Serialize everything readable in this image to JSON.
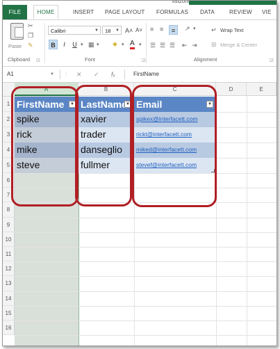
{
  "window": {
    "title_fragment": "listzorar"
  },
  "ribbon_tabs": [
    "FILE",
    "HOME",
    "INSERT",
    "PAGE LAYOUT",
    "FORMULAS",
    "DATA",
    "REVIEW",
    "VIE"
  ],
  "ribbon": {
    "paste_label": "Paste",
    "font_name": "Calibri",
    "font_size": "18",
    "bold": "B",
    "italic": "I",
    "underline": "U",
    "grow_font": "A˄",
    "shrink_font": "A˅",
    "font_color": "A",
    "wrap_text": "Wrap Text",
    "merge_center": "Merge & Center",
    "group_clipboard": "Clipboard",
    "group_font": "Font",
    "group_alignment": "Alignment"
  },
  "formula_bar": {
    "name_box": "A1",
    "cancel": "✕",
    "enter": "✓",
    "fx": "fₓ",
    "value": "FirstName"
  },
  "columns": [
    "A",
    "B",
    "C",
    "D",
    "E"
  ],
  "rows": [
    "1",
    "2",
    "3",
    "4",
    "5",
    "6",
    "7",
    "8",
    "9",
    "10",
    "11",
    "12",
    "13",
    "14",
    "15",
    "16"
  ],
  "table": {
    "headers": [
      "FirstName",
      "LastName",
      "Email"
    ],
    "records": [
      {
        "first": "spike",
        "last": "xavier",
        "email": "spikex@interfacett.com"
      },
      {
        "first": "rick",
        "last": "trader",
        "email": "rickt@interfacett.com"
      },
      {
        "first": "mike",
        "last": "danseglio",
        "email": "miked@interfacett.com"
      },
      {
        "first": "steve",
        "last": "fullmer",
        "email": "stevef@interfacett.com"
      }
    ]
  },
  "colors": {
    "excel_green": "#217346",
    "table_header": "#5b86c5",
    "band_dark": "#b8c9e2",
    "band_light": "#dce6f2",
    "highlight_oval": "#b01f24"
  }
}
